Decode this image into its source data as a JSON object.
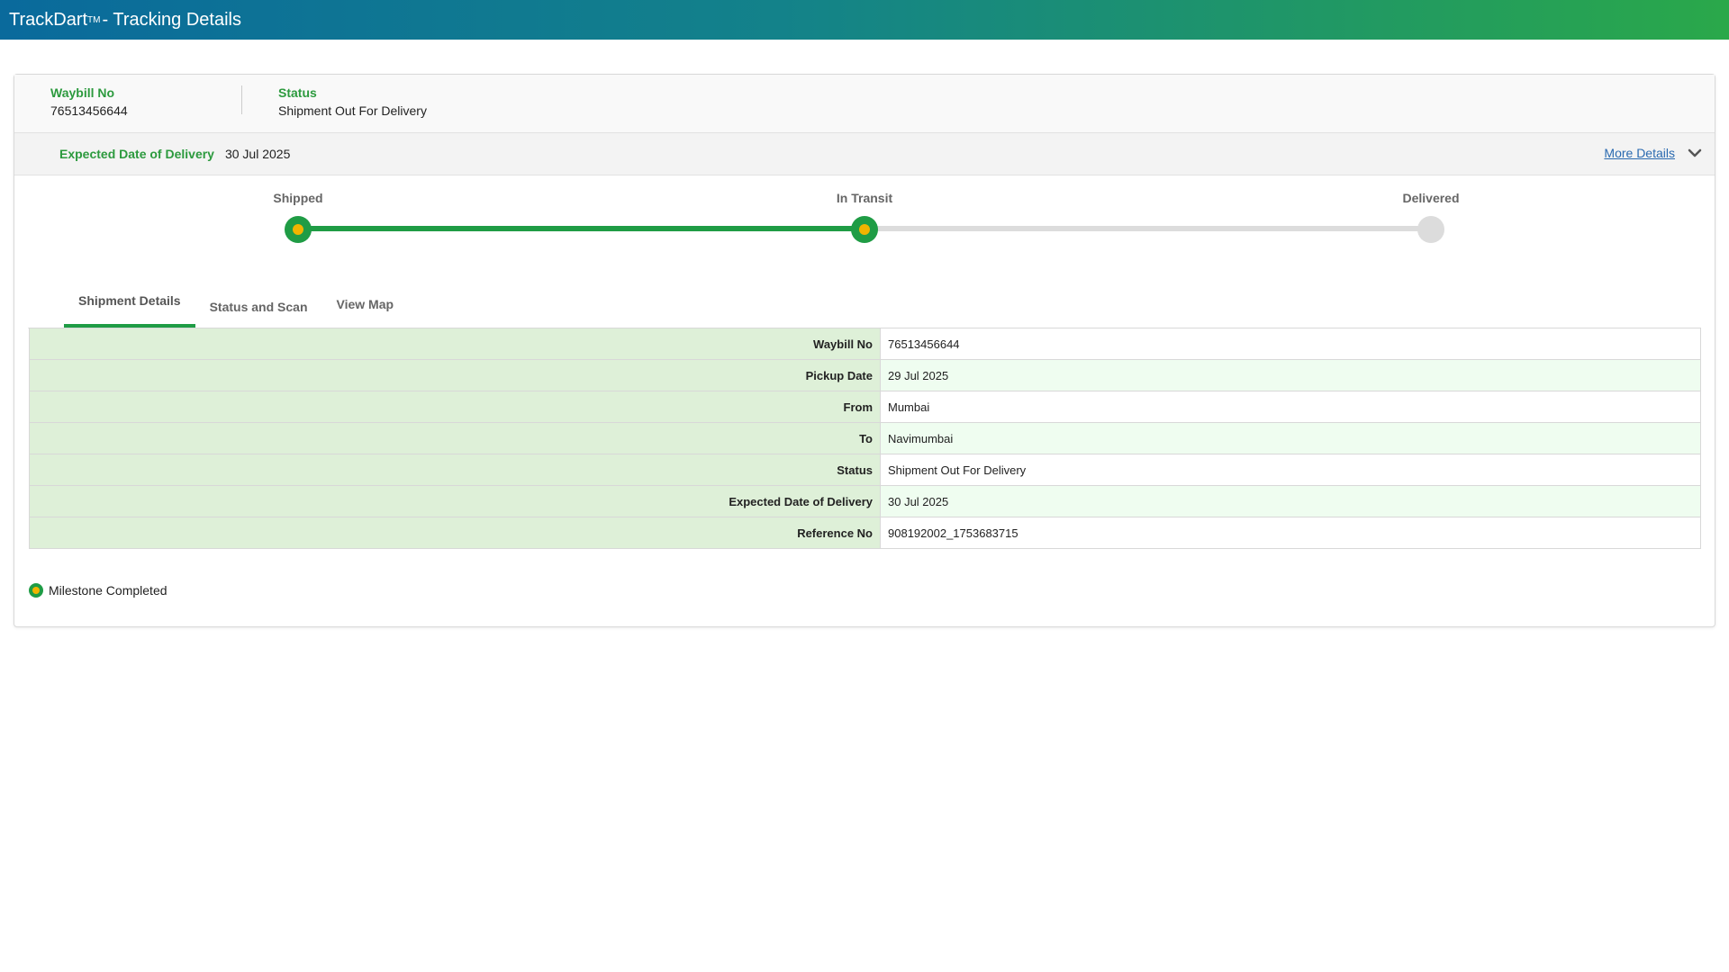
{
  "header": {
    "brand": "TrackDart",
    "tm": "TM",
    "title_suffix": " - Tracking Details"
  },
  "summary": {
    "waybill_label": "Waybill No",
    "waybill_value": "76513456644",
    "status_label": "Status",
    "status_value": "Shipment Out For Delivery"
  },
  "edd": {
    "label": "Expected Date of Delivery",
    "value": "30 Jul 2025",
    "more_details": "More Details",
    "toggle_icon": "chevron-down-icon"
  },
  "progress": {
    "stages": [
      {
        "label": "Shipped",
        "state": "done"
      },
      {
        "label": "In Transit",
        "state": "done"
      },
      {
        "label": "Delivered",
        "state": "pending"
      }
    ],
    "completed_fraction": 0.5,
    "colors": {
      "done": "#1f9c45",
      "dot": "#f0b400",
      "pending": "#dcdcdc"
    }
  },
  "tabs": [
    {
      "label": "Shipment Details",
      "active": true
    },
    {
      "label": "Status and Scan",
      "active": false
    },
    {
      "label": "View Map",
      "active": false
    }
  ],
  "details": [
    {
      "key": "Waybill No",
      "value": "76513456644"
    },
    {
      "key": "Pickup Date",
      "value": "29 Jul 2025"
    },
    {
      "key": "From",
      "value": "Mumbai"
    },
    {
      "key": "To",
      "value": "Navimumbai"
    },
    {
      "key": "Status",
      "value": "Shipment Out For Delivery"
    },
    {
      "key": "Expected Date of Delivery",
      "value": "30 Jul 2025"
    },
    {
      "key": "Reference No",
      "value": "908192002_1753683715"
    }
  ],
  "legend": {
    "label": "Milestone Completed",
    "icon": "milestone-dot-icon"
  }
}
